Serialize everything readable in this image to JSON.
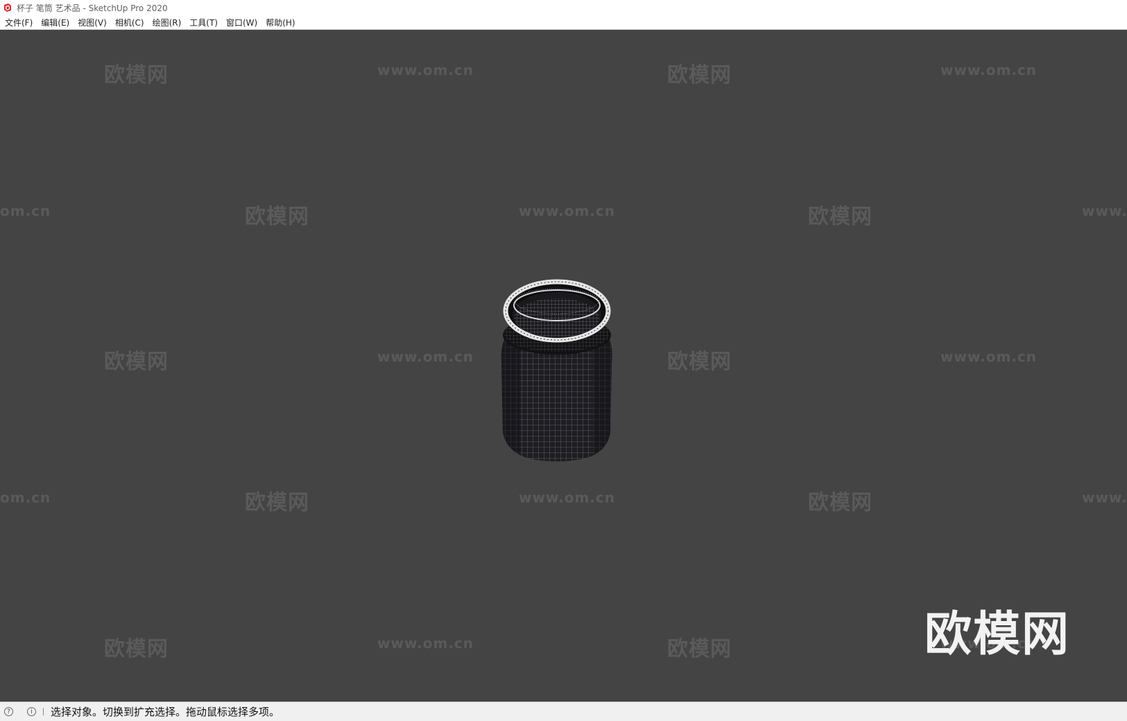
{
  "window": {
    "title": "杯子 笔筒 艺术品 - SketchUp Pro 2020",
    "app_icon": "sketchup-logo-icon"
  },
  "menu": [
    {
      "label": "文件(F)"
    },
    {
      "label": "编辑(E)"
    },
    {
      "label": "视图(V)"
    },
    {
      "label": "相机(C)"
    },
    {
      "label": "绘图(R)"
    },
    {
      "label": "工具(T)"
    },
    {
      "label": "窗口(W)"
    },
    {
      "label": "帮助(H)"
    }
  ],
  "viewport": {
    "background": "#444444",
    "model": "wireframe-jar",
    "watermarks": {
      "brand": "欧模网",
      "url": "www.om.cn",
      "url_partial_left": "om.cn",
      "url_partial_right": "www."
    }
  },
  "statusbar": {
    "icons": [
      "geolocation-icon",
      "info-icon"
    ],
    "message": "选择对象。切换到扩充选择。拖动鼠标选择多项。"
  }
}
